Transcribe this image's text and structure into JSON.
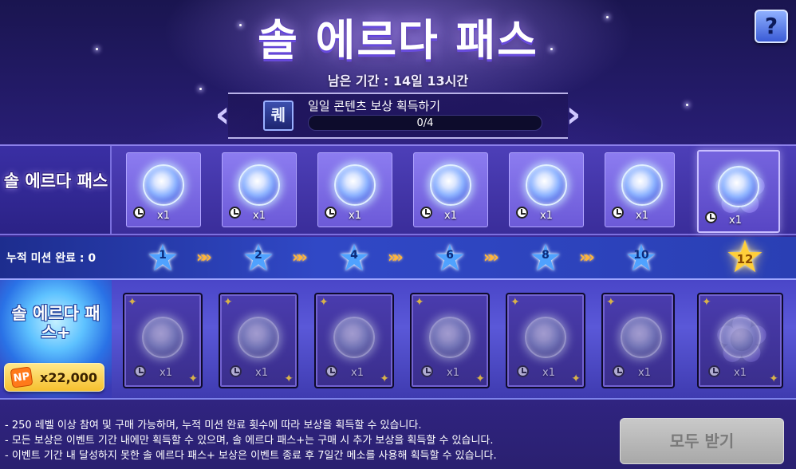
{
  "header": {
    "title": "솔 에르다 패스",
    "period_text": "남은 기간 : 14일 13시간",
    "help_label": "?"
  },
  "daily_mission": {
    "icon_glyph": "퀘",
    "label": "일일 콘텐츠 보상 획득하기",
    "progress_text": "0/4",
    "progress": 0
  },
  "free_pass": {
    "label": "솔 에르다 패스",
    "rewards": [
      {
        "qty": "x1"
      },
      {
        "qty": "x1"
      },
      {
        "qty": "x1"
      },
      {
        "qty": "x1"
      },
      {
        "qty": "x1"
      },
      {
        "qty": "x1"
      },
      {
        "qty": "x1"
      }
    ]
  },
  "progress_row": {
    "label": "누적 미션 완료 : 0",
    "milestones": [
      "1",
      "2",
      "4",
      "6",
      "8",
      "10",
      "12"
    ],
    "arrow_glyph": "»»"
  },
  "plus_pass": {
    "label": "솔 에르다 패스+",
    "price": "x22,000",
    "currency_icon": "NP",
    "rewards": [
      {
        "qty": "x1"
      },
      {
        "qty": "x1"
      },
      {
        "qty": "x1"
      },
      {
        "qty": "x1"
      },
      {
        "qty": "x1"
      },
      {
        "qty": "x1"
      },
      {
        "qty": "x1"
      }
    ]
  },
  "footer": {
    "notes": [
      "- 250 레벨 이상 참여 및 구매 가능하며, 누적 미션 완료 횟수에 따라 보상을 획득할 수 있습니다.",
      "- 모든 보상은 이벤트 기간 내에만 획득할 수 있으며, 솔 에르다 패스+는 구매 시 추가 보상을 획득할 수 있습니다.",
      "- 이벤트 기간 내 달성하지 못한 솔 에르다 패스+ 보상은 이벤트 종료 후 7일간 메소를 사용해 획득할 수 있습니다."
    ],
    "receive_all_label": "모두 받기"
  },
  "colors": {
    "accent_star": "#4fa2ff",
    "final_star": "#ffcf3a",
    "price_button": "#f6c02e",
    "disabled_button": "#b8b8b8"
  }
}
